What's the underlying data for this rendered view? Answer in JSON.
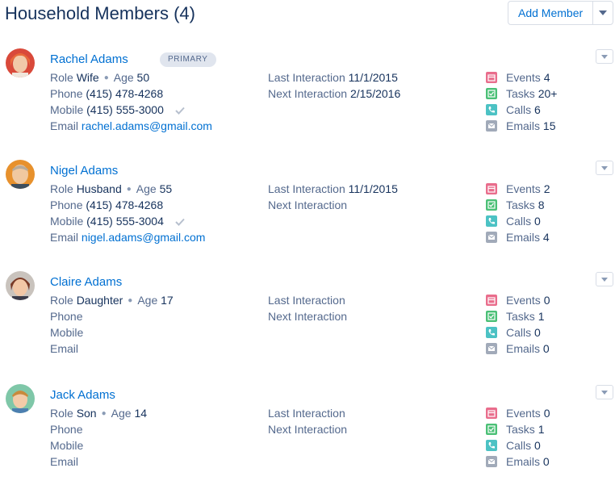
{
  "header": {
    "title": "Household Members (4)",
    "add_member_label": "Add Member"
  },
  "labels": {
    "role": "Role",
    "age": "Age",
    "phone": "Phone",
    "mobile": "Mobile",
    "email": "Email",
    "last_interaction": "Last Interaction",
    "next_interaction": "Next Interaction",
    "events": "Events",
    "tasks": "Tasks",
    "calls": "Calls",
    "emails": "Emails"
  },
  "colors": {
    "events": "#e96d8c",
    "tasks": "#4bc076",
    "calls": "#4cc2c4",
    "emails": "#a1aab9",
    "link": "#0070d2"
  },
  "members": [
    {
      "name": "Rachel Adams",
      "badge": "PRIMARY",
      "role": "Wife",
      "age": "50",
      "phone": "(415) 478-4268",
      "mobile": "(415) 555-3000",
      "email": "rachel.adams@gmail.com",
      "last_interaction": "11/1/2015",
      "next_interaction": "2/15/2016",
      "events": "4",
      "tasks": "20+",
      "calls": "6",
      "emails": "15"
    },
    {
      "name": "Nigel Adams",
      "role": "Husband",
      "age": "55",
      "phone": "(415) 478-4268",
      "mobile": "(415) 555-3004",
      "email": "nigel.adams@gmail.com",
      "last_interaction": "11/1/2015",
      "next_interaction": "",
      "events": "2",
      "tasks": "8",
      "calls": "0",
      "emails": "4"
    },
    {
      "name": "Claire Adams",
      "role": "Daughter",
      "age": "17",
      "phone": "",
      "mobile": "",
      "email": "",
      "last_interaction": "",
      "next_interaction": "",
      "events": "0",
      "tasks": "1",
      "calls": "0",
      "emails": "0"
    },
    {
      "name": "Jack Adams",
      "role": "Son",
      "age": "14",
      "phone": "",
      "mobile": "",
      "email": "",
      "last_interaction": "",
      "next_interaction": "",
      "events": "0",
      "tasks": "1",
      "calls": "0",
      "emails": "0"
    }
  ]
}
